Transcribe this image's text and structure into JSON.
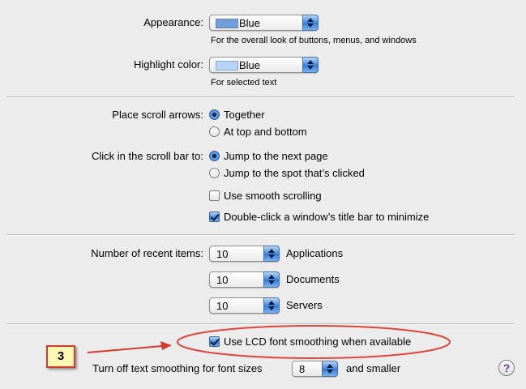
{
  "appearance": {
    "label": "Appearance:",
    "value": "Blue",
    "swatch_color": "#6f9fdc",
    "hint": "For the overall look of buttons, menus, and windows"
  },
  "highlight": {
    "label": "Highlight color:",
    "value": "Blue",
    "swatch_color": "#b7d3f5",
    "hint": "For selected text"
  },
  "scroll_arrows": {
    "label": "Place scroll arrows:",
    "options": [
      "Together",
      "At top and bottom"
    ],
    "selected": "Together"
  },
  "scroll_bar_click": {
    "label": "Click in the scroll bar to:",
    "options": [
      "Jump to the next page",
      "Jump to the spot that’s clicked"
    ],
    "selected": "Jump to the next page"
  },
  "smooth_scrolling": {
    "label": "Use smooth scrolling",
    "checked": false
  },
  "double_click_minimize": {
    "label": "Double-click a window’s title bar to minimize",
    "checked": true
  },
  "recent_items": {
    "label": "Number of recent items:",
    "rows": [
      {
        "value": "10",
        "label": "Applications"
      },
      {
        "value": "10",
        "label": "Documents"
      },
      {
        "value": "10",
        "label": "Servers"
      }
    ]
  },
  "lcd_smoothing": {
    "label": "Use LCD font smoothing when available",
    "checked": true
  },
  "text_smoothing": {
    "label": "Turn off text smoothing for font sizes",
    "value": "8",
    "suffix": "and smaller"
  },
  "annotation": {
    "number": "3",
    "color": "#e0453a"
  },
  "help_button": {
    "glyph": "?"
  }
}
